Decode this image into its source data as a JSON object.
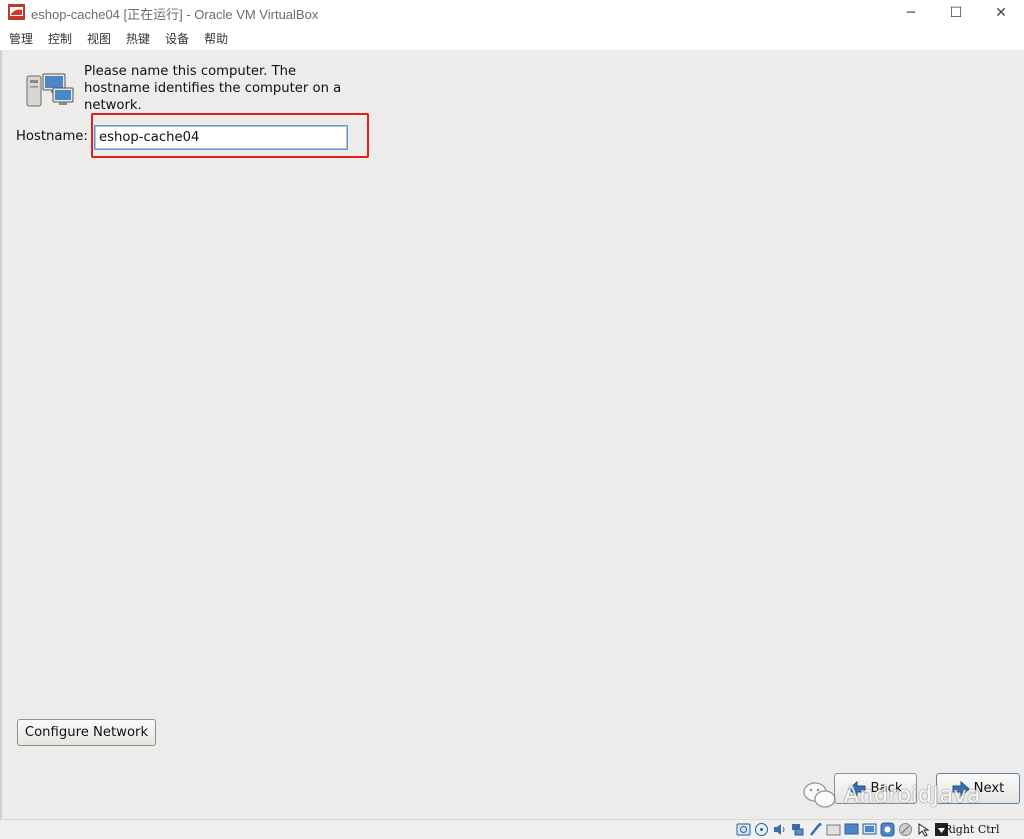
{
  "window": {
    "title": "eshop-cache04 [正在运行] - Oracle VM VirtualBox",
    "minimize_glyph": "─",
    "maximize_glyph": "☐",
    "close_glyph": "✕"
  },
  "menu": [
    {
      "label": "管理"
    },
    {
      "label": "控制"
    },
    {
      "label": "视图"
    },
    {
      "label": "热键"
    },
    {
      "label": "设备"
    },
    {
      "label": "帮助"
    }
  ],
  "installer": {
    "prompt": "Please name this computer.  The hostname identifies the computer on a network.",
    "hostname_label": "Hostname:",
    "hostname_value": "eshop-cache04",
    "configure_network_label": "Configure Network",
    "back_label": "Back",
    "next_label": "Next",
    "highlight_color": "#e02020"
  },
  "watermark": {
    "text": "AndroidJava"
  },
  "statusbar": {
    "icons": [
      "hard-disk-icon",
      "optical-drive-icon",
      "audio-icon",
      "network-icon",
      "usb-icon",
      "shared-folder-icon",
      "display-icon",
      "video-capture-icon",
      "recording-icon",
      "cpu-icon",
      "mouse-integration-icon",
      "keyboard-icon"
    ],
    "host_key": "Right Ctrl"
  }
}
